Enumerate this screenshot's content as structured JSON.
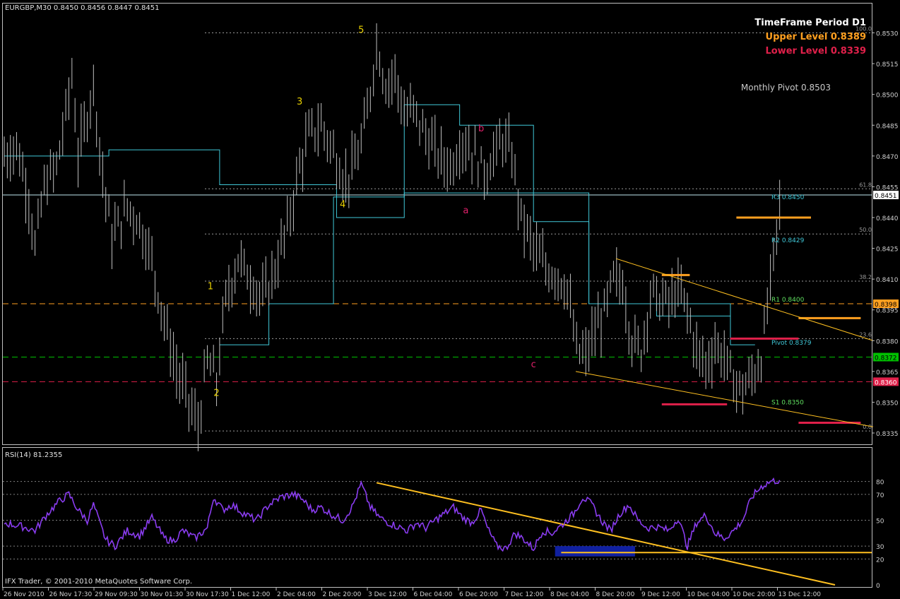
{
  "header": {
    "symbol_line": "EURGBP,M30  0.8450 0.8456 0.8447 0.8451"
  },
  "info_panel": {
    "timeframe": "TimeFrame Period D1",
    "upper_level": "Upper Level 0.8389",
    "lower_level": "Lower Level 0.8339",
    "monthly_pivot": "Monthly Pivot 0.8503"
  },
  "rsi_header": "RSI(14) 81.2355",
  "copyright": "IFX Trader, © 2001-2010 MetaQuotes Software Corp.",
  "colors": {
    "background": "#000000",
    "grid_frame": "#c0c0c0",
    "bars": "#bfbfbf",
    "steps": "#40c8d8",
    "orange": "#ffa020",
    "red": "#e0204a",
    "green": "#00c000",
    "yellow_label": "#e8d000",
    "wave_label_magenta": "#e0206a",
    "rsi_line": "#8a3cf0",
    "trend_line": "#ffc020",
    "rsi_box": "#1020a0"
  },
  "chart_data": [
    {
      "type": "candlestick",
      "title": "EURGBP,M30",
      "ylim": [
        0.8335,
        0.8535
      ],
      "y_ticks": [
        "0.8530",
        "0.8515",
        "0.8500",
        "0.8485",
        "0.8470",
        "0.8455",
        "0.8440",
        "0.8425",
        "0.8410",
        "0.8395",
        "0.8380",
        "0.8365",
        "0.8350",
        "0.8335"
      ],
      "x_ticks": [
        "26 Nov 2010",
        "26 Nov 17:30",
        "29 Nov 09:30",
        "30 Nov 01:30",
        "30 Nov 17:30",
        "1 Dec 12:00",
        "2 Dec 04:00",
        "2 Dec 20:00",
        "3 Dec 12:00",
        "6 Dec 04:00",
        "6 Dec 20:00",
        "7 Dec 12:00",
        "8 Dec 04:00",
        "8 Dec 20:00",
        "9 Dec 12:00",
        "10 Dec 04:00",
        "10 Dec 20:00",
        "13 Dec 12:00"
      ],
      "price_path": [
        [
          0,
          0.847
        ],
        [
          4,
          0.8475
        ],
        [
          8,
          0.845
        ],
        [
          10,
          0.8425
        ],
        [
          13,
          0.8455
        ],
        [
          17,
          0.8465
        ],
        [
          20,
          0.849
        ],
        [
          22,
          0.851
        ],
        [
          24,
          0.847
        ],
        [
          27,
          0.849
        ],
        [
          29,
          0.8505
        ],
        [
          32,
          0.846
        ],
        [
          35,
          0.843
        ],
        [
          40,
          0.8445
        ],
        [
          43,
          0.844
        ],
        [
          47,
          0.8425
        ],
        [
          52,
          0.839
        ],
        [
          56,
          0.8365
        ],
        [
          60,
          0.835
        ],
        [
          63,
          0.8338
        ],
        [
          66,
          0.837
        ],
        [
          69,
          0.836
        ],
        [
          72,
          0.84
        ],
        [
          76,
          0.842
        ],
        [
          80,
          0.841
        ],
        [
          84,
          0.84
        ],
        [
          88,
          0.8415
        ],
        [
          92,
          0.8435
        ],
        [
          96,
          0.8465
        ],
        [
          99,
          0.848
        ],
        [
          103,
          0.8485
        ],
        [
          107,
          0.8472
        ],
        [
          111,
          0.8458
        ],
        [
          115,
          0.847
        ],
        [
          118,
          0.849
        ],
        [
          121,
          0.8525
        ],
        [
          124,
          0.8505
        ],
        [
          127,
          0.851
        ],
        [
          130,
          0.849
        ],
        [
          133,
          0.8492
        ],
        [
          137,
          0.848
        ],
        [
          141,
          0.847
        ],
        [
          145,
          0.8465
        ],
        [
          149,
          0.8478
        ],
        [
          153,
          0.847
        ],
        [
          156,
          0.8462
        ],
        [
          159,
          0.847
        ],
        [
          162,
          0.8478
        ],
        [
          165,
          0.847
        ],
        [
          168,
          0.844
        ],
        [
          172,
          0.8425
        ],
        [
          176,
          0.8415
        ],
        [
          180,
          0.8412
        ],
        [
          183,
          0.8405
        ],
        [
          186,
          0.8375
        ],
        [
          189,
          0.8372
        ],
        [
          192,
          0.8385
        ],
        [
          195,
          0.8393
        ],
        [
          198,
          0.841
        ],
        [
          201,
          0.8408
        ],
        [
          204,
          0.838
        ],
        [
          207,
          0.8375
        ],
        [
          210,
          0.8403
        ],
        [
          213,
          0.84
        ],
        [
          216,
          0.8398
        ],
        [
          219,
          0.8405
        ],
        [
          222,
          0.8395
        ],
        [
          225,
          0.8375
        ],
        [
          228,
          0.8368
        ],
        [
          231,
          0.8378
        ],
        [
          234,
          0.8372
        ],
        [
          237,
          0.836
        ],
        [
          240,
          0.8356
        ],
        [
          243,
          0.8362
        ],
        [
          246,
          0.8372
        ],
        [
          248,
          0.8395
        ],
        [
          250,
          0.842
        ],
        [
          252,
          0.8445
        ],
        [
          253,
          0.8451
        ]
      ],
      "horizontal_levels": [
        {
          "label": "0.8451",
          "value": 0.8451,
          "style": "bid"
        },
        {
          "label": "0.8398",
          "value": 0.8398,
          "style": "orange-dash"
        },
        {
          "label": "0.8372",
          "value": 0.8372,
          "style": "green-dash"
        },
        {
          "label": "0.8360",
          "value": 0.836,
          "style": "red-dash"
        }
      ],
      "fibonacci": [
        {
          "label": "100.0",
          "value": 0.853
        },
        {
          "label": "61.8",
          "value": 0.8454
        },
        {
          "label": "50.0",
          "value": 0.8432
        },
        {
          "label": "38.2",
          "value": 0.8409
        },
        {
          "label": "23.6",
          "value": 0.8381
        },
        {
          "label": "0.0",
          "value": 0.8336
        }
      ],
      "pivots": [
        {
          "label": "R3 0.8450",
          "value": 0.845
        },
        {
          "label": "R2 0.8429",
          "value": 0.8429
        },
        {
          "label": "R1 0.8400",
          "value": 0.84
        },
        {
          "label": "Pivot 0.8379",
          "value": 0.8379
        },
        {
          "label": "S1 0.8350",
          "value": 0.835
        }
      ],
      "wave_labels": [
        {
          "label": "1",
          "bar": 67,
          "value": 0.8405,
          "color": "yellow"
        },
        {
          "label": "2",
          "bar": 69,
          "value": 0.8353,
          "color": "yellow"
        },
        {
          "label": "3",
          "bar": 96,
          "value": 0.8495,
          "color": "yellow"
        },
        {
          "label": "4",
          "bar": 110,
          "value": 0.8445,
          "color": "yellow"
        },
        {
          "label": "5",
          "bar": 116,
          "value": 0.853,
          "color": "yellow"
        },
        {
          "label": "a",
          "bar": 150,
          "value": 0.8442,
          "color": "magenta"
        },
        {
          "label": "b",
          "bar": 155,
          "value": 0.8482,
          "color": "magenta"
        },
        {
          "label": "c",
          "bar": 172,
          "value": 0.8367,
          "color": "magenta"
        }
      ]
    },
    {
      "type": "line",
      "title": "RSI(14)",
      "ylim": [
        0,
        100
      ],
      "y_ticks": [
        "80",
        "70",
        "50",
        "30",
        "20",
        "0"
      ],
      "last_value": 81.2355,
      "series": [
        {
          "name": "RSI(14)",
          "points": [
            [
              0,
              48
            ],
            [
              6,
              45
            ],
            [
              10,
              42
            ],
            [
              14,
              55
            ],
            [
              18,
              65
            ],
            [
              21,
              70
            ],
            [
              24,
              58
            ],
            [
              27,
              50
            ],
            [
              29,
              62
            ],
            [
              31,
              48
            ],
            [
              33,
              35
            ],
            [
              36,
              30
            ],
            [
              40,
              42
            ],
            [
              44,
              38
            ],
            [
              48,
              52
            ],
            [
              52,
              36
            ],
            [
              55,
              34
            ],
            [
              58,
              42
            ],
            [
              62,
              36
            ],
            [
              66,
              44
            ],
            [
              68,
              68
            ],
            [
              71,
              58
            ],
            [
              74,
              62
            ],
            [
              78,
              55
            ],
            [
              82,
              50
            ],
            [
              86,
              62
            ],
            [
              90,
              68
            ],
            [
              94,
              70
            ],
            [
              97,
              66
            ],
            [
              100,
              58
            ],
            [
              103,
              60
            ],
            [
              106,
              55
            ],
            [
              110,
              50
            ],
            [
              113,
              60
            ],
            [
              116,
              78
            ],
            [
              119,
              60
            ],
            [
              122,
              52
            ],
            [
              125,
              48
            ],
            [
              128,
              45
            ],
            [
              131,
              42
            ],
            [
              134,
              48
            ],
            [
              137,
              44
            ],
            [
              140,
              50
            ],
            [
              143,
              55
            ],
            [
              146,
              60
            ],
            [
              149,
              52
            ],
            [
              152,
              48
            ],
            [
              155,
              58
            ],
            [
              157,
              44
            ],
            [
              160,
              30
            ],
            [
              163,
              28
            ],
            [
              166,
              40
            ],
            [
              169,
              35
            ],
            [
              172,
              28
            ],
            [
              175,
              42
            ],
            [
              178,
              40
            ],
            [
              182,
              48
            ],
            [
              185,
              55
            ],
            [
              188,
              68
            ],
            [
              191,
              62
            ],
            [
              194,
              50
            ],
            [
              197,
              42
            ],
            [
              200,
              55
            ],
            [
              203,
              62
            ],
            [
              206,
              50
            ],
            [
              209,
              44
            ],
            [
              212,
              45
            ],
            [
              216,
              42
            ],
            [
              219,
              52
            ],
            [
              222,
              30
            ],
            [
              225,
              48
            ],
            [
              228,
              54
            ],
            [
              231,
              40
            ],
            [
              234,
              36
            ],
            [
              237,
              42
            ],
            [
              240,
              50
            ],
            [
              243,
              68
            ],
            [
              246,
              76
            ],
            [
              249,
              80
            ],
            [
              252,
              81
            ]
          ]
        }
      ]
    }
  ]
}
